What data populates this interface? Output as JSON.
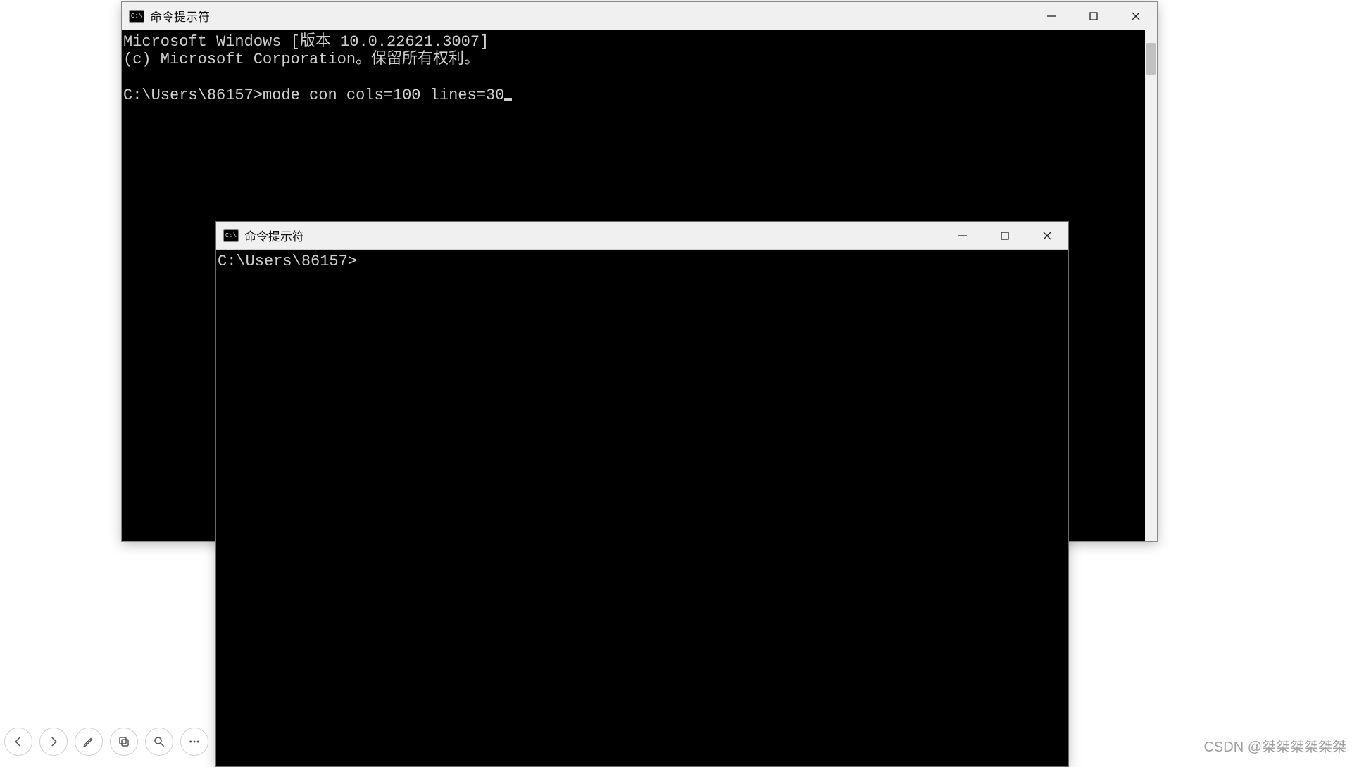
{
  "windows": {
    "back": {
      "title": "命令提示符",
      "icon_text": "C:\\",
      "lines": {
        "l1": "Microsoft Windows [版本 10.0.22621.3007]",
        "l2": "(c) Microsoft Corporation。保留所有权利。",
        "l3": "",
        "prompt": "C:\\Users\\86157>",
        "command": "mode con cols=100 lines=30"
      }
    },
    "front": {
      "title": "命令提示符",
      "icon_text": "C:\\",
      "prompt": "C:\\Users\\86157>"
    }
  },
  "toolbar": {
    "prev": "prev",
    "next": "next",
    "edit": "edit",
    "copy": "copy",
    "zoom": "zoom",
    "more": "more"
  },
  "watermark": "CSDN @桀桀桀桀桀桀"
}
